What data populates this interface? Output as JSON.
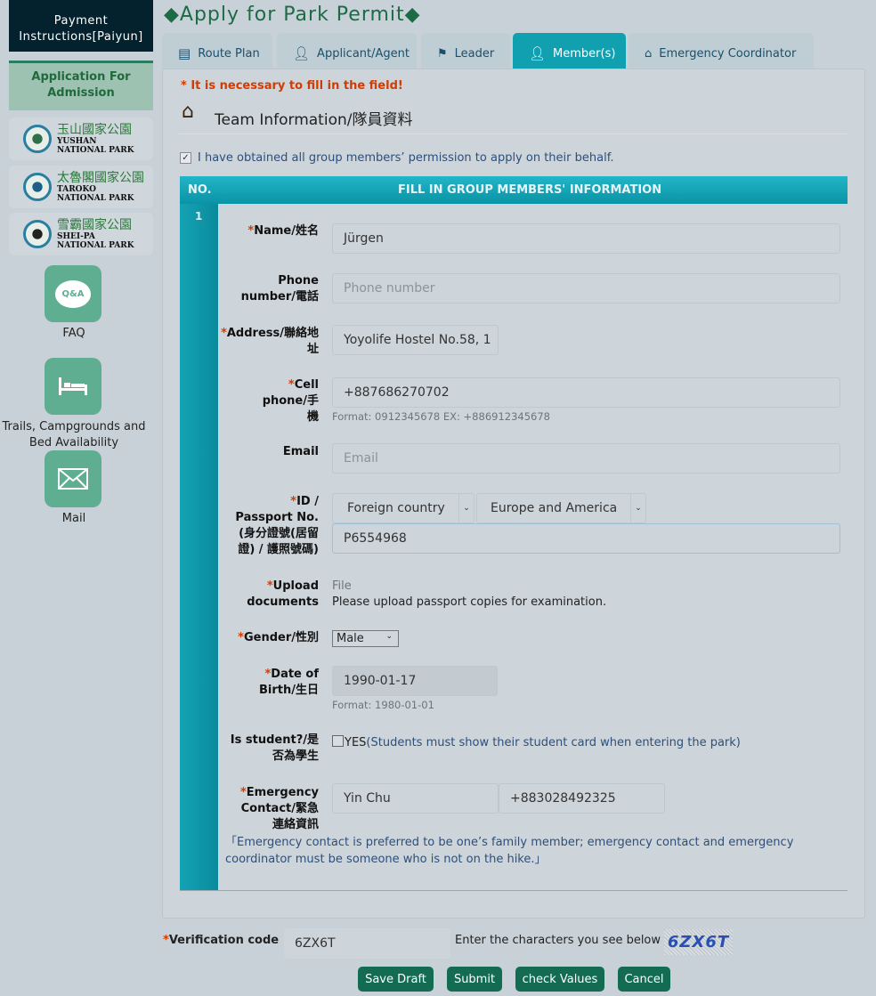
{
  "sidebar": {
    "payment": "Payment Instructions[Paiyun]",
    "admission": "Application For Admission",
    "parks": [
      {
        "cn": "玉山國家公園",
        "en1": "YUSHAN",
        "en2": "NATIONAL PARK"
      },
      {
        "cn": "太魯閣國家公園",
        "en1": "TAROKO",
        "en2": "NATIONAL PARK"
      },
      {
        "cn": "雪霸國家公園",
        "en1": "SHEI-PA",
        "en2": "NATIONAL PARK"
      }
    ],
    "links": [
      {
        "label": "FAQ",
        "icon": "qa-bubble-icon",
        "glyph": "Q&A"
      },
      {
        "label": "Trails, Campgrounds and Bed Availability",
        "icon": "bed-icon"
      },
      {
        "label": "Mail",
        "icon": "mail-icon"
      }
    ]
  },
  "header": {
    "title": "◆Apply for Park Permit◆"
  },
  "tabs": [
    {
      "label": "Route Plan",
      "icon": "list-icon"
    },
    {
      "label": "Applicant/Agent",
      "icon": "user-icon"
    },
    {
      "label": "Leader",
      "icon": "flag-icon"
    },
    {
      "label": "Member(s)",
      "icon": "user-icon",
      "active": true
    },
    {
      "label": "Emergency Coordinator",
      "icon": "home-icon"
    }
  ],
  "form": {
    "required_note": "* It is necessary to fill in the field!",
    "section_title": "Team Information/隊員資料",
    "permission": "I have obtained all group members’ permission to apply on their behalf.",
    "permission_checked": true,
    "table_header_no": "NO.",
    "table_header_info": "FILL IN GROUP MEMBERS' INFORMATION",
    "member_no": "1",
    "name_label": "Name/姓名",
    "name_value": "Jürgen",
    "phone_label": "Phone number/電話",
    "phone_placeholder": "Phone number",
    "address_label": "Address/聯絡地址",
    "address_value": "Yoyolife Hostel No.58, 1",
    "cell_label": "Cell phone/手機",
    "cell_value": "+887686270702",
    "cell_hint": "Format: 0912345678 EX: +886912345678",
    "email_label": "Email",
    "email_placeholder": "Email",
    "id_label": "ID / Passport No. (身分證號(居留證) / 護照號碼)",
    "id_type": "Foreign country",
    "id_region": "Europe and America",
    "id_value": "P6554968",
    "upload_label": "Upload documents",
    "upload_file": "File",
    "upload_hint": "Please upload passport copies for examination.",
    "gender_label": "Gender/性別",
    "gender_value": "Male",
    "dob_label": "Date of Birth/生日",
    "dob_value": "1990-01-17",
    "dob_hint": "Format: 1980-01-01",
    "student_label": "Is student?/是否為學生",
    "student_yes": "YES",
    "student_note": "(Students must show their student card when entering the park)",
    "emerg_label": "Emergency Contact/緊急連絡資訊",
    "emerg_name": "Yin Chu",
    "emerg_phone": "+883028492325",
    "emerg_note": "「Emergency contact is preferred to be one’s family member; emergency contact and emergency coordinator must be someone who is not on the hike.」"
  },
  "footer": {
    "verify_label": "Verification code",
    "verify_value": "6ZX6T",
    "verify_hint": "Enter the characters you see below",
    "captcha": "6ZX6T",
    "buttons": [
      "Save Draft",
      "Submit",
      "check Values",
      "Cancel"
    ]
  }
}
